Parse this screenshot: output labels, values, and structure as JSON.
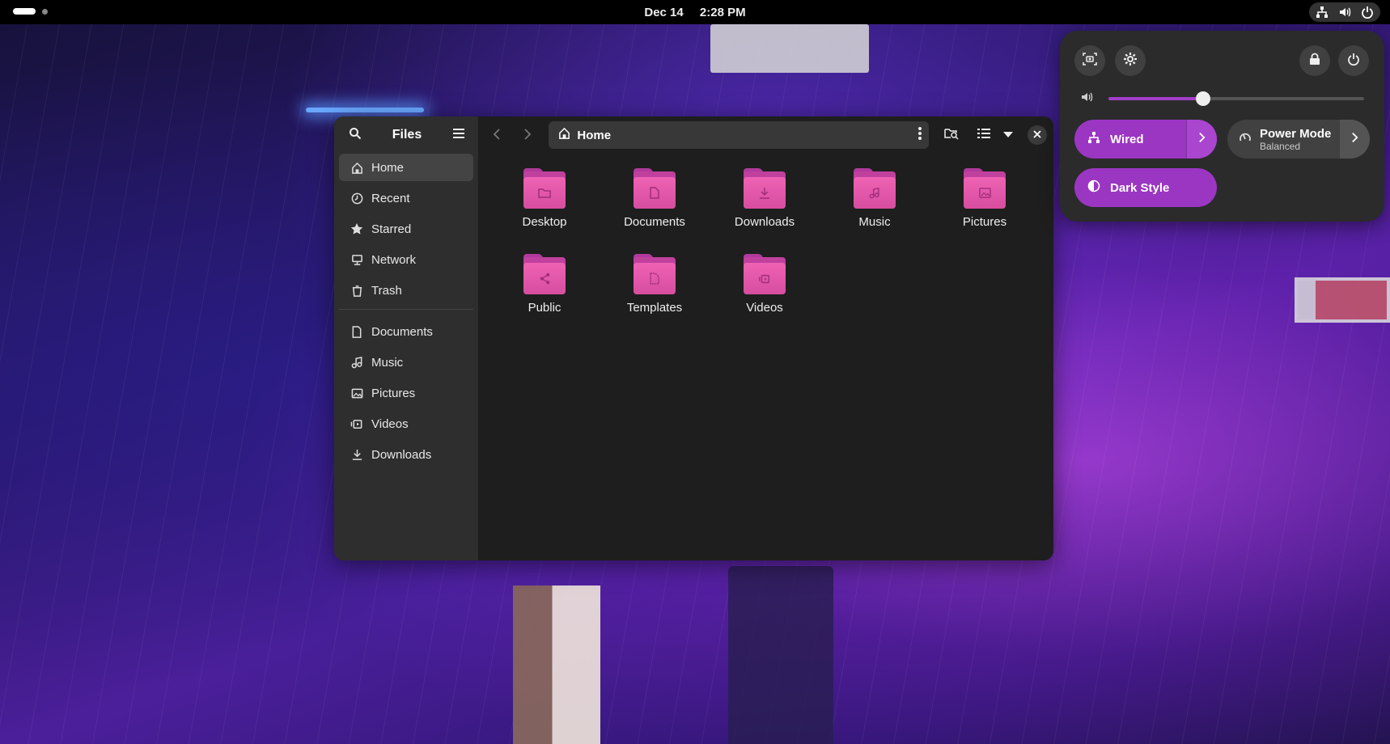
{
  "topbar": {
    "date": "Dec 14",
    "time": "2:28 PM",
    "tray_icons": [
      "network-icon",
      "volume-icon",
      "power-icon"
    ]
  },
  "files": {
    "title": "Files",
    "sidebar": {
      "places": [
        {
          "label": "Home",
          "icon": "home-icon",
          "active": true
        },
        {
          "label": "Recent",
          "icon": "clock-icon"
        },
        {
          "label": "Starred",
          "icon": "star-icon"
        },
        {
          "label": "Network",
          "icon": "network-icon"
        },
        {
          "label": "Trash",
          "icon": "trash-icon"
        }
      ],
      "bookmarks": [
        {
          "label": "Documents",
          "icon": "document-icon"
        },
        {
          "label": "Music",
          "icon": "music-icon"
        },
        {
          "label": "Pictures",
          "icon": "picture-icon"
        },
        {
          "label": "Videos",
          "icon": "video-icon"
        },
        {
          "label": "Downloads",
          "icon": "download-icon"
        }
      ]
    },
    "path": "Home",
    "folders": [
      {
        "label": "Desktop",
        "icon": "folder-desktop-icon"
      },
      {
        "label": "Documents",
        "icon": "folder-documents-icon"
      },
      {
        "label": "Downloads",
        "icon": "folder-downloads-icon"
      },
      {
        "label": "Music",
        "icon": "folder-music-icon"
      },
      {
        "label": "Pictures",
        "icon": "folder-pictures-icon"
      },
      {
        "label": "Public",
        "icon": "folder-public-icon"
      },
      {
        "label": "Templates",
        "icon": "folder-templates-icon"
      },
      {
        "label": "Videos",
        "icon": "folder-videos-icon"
      }
    ]
  },
  "quick_settings": {
    "volume_level": 0.37,
    "wired_label": "Wired",
    "power_mode_label": "Power Mode",
    "power_mode_value": "Balanced",
    "dark_style_label": "Dark Style",
    "accent_color": "#9b36c3",
    "folder_color": "#e45aae"
  }
}
